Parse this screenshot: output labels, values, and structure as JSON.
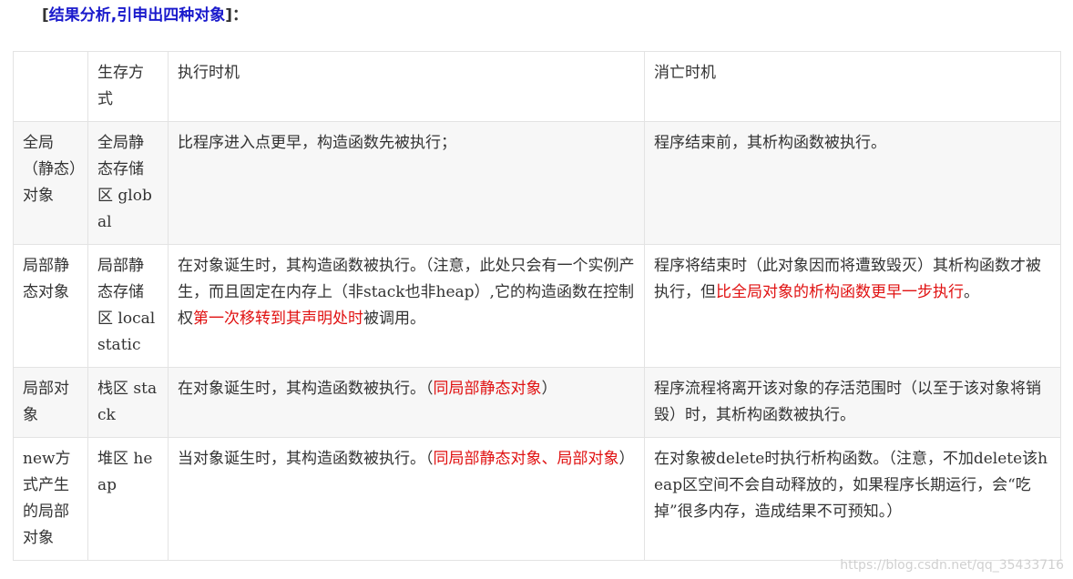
{
  "heading": {
    "open_bracket": "[",
    "text": "结果分析,引申出四种对象",
    "close": "]："
  },
  "table": {
    "header": [
      "",
      "生存方式",
      "执行时机",
      "消亡时机"
    ],
    "rows": [
      {
        "type": "全局（静态）对象",
        "storage": "全局静态存储区 global",
        "exec": [
          {
            "t": "比程序进入点更早，构造函数先被执行；",
            "red": false
          }
        ],
        "death": [
          {
            "t": "程序结束前，其析构函数被执行。",
            "red": false
          }
        ]
      },
      {
        "type": "局部静态对象",
        "storage": "局部静态存储区 local static",
        "exec": [
          {
            "t": "在对象诞生时，其构造函数被执行。（注意，此处只会有一个实例产生，而且固定在内存上（非stack也非heap）,它的构造函数在控制权",
            "red": false
          },
          {
            "t": "第一次移转到其声明处时",
            "red": true
          },
          {
            "t": "被调用。",
            "red": false
          }
        ],
        "death": [
          {
            "t": "程序将结束时（此对象因而将遭致毁灭）其析构函数才被执行，但",
            "red": false
          },
          {
            "t": "比全局对象的析构函数更早一步执行",
            "red": true
          },
          {
            "t": "。",
            "red": false
          }
        ]
      },
      {
        "type": "局部对象",
        "storage": "栈区 stack",
        "exec": [
          {
            "t": "在对象诞生时，其构造函数被执行。（",
            "red": false
          },
          {
            "t": "同局部静态对象",
            "red": true
          },
          {
            "t": "）",
            "red": false
          }
        ],
        "death": [
          {
            "t": "程序流程将离开该对象的存活范围时（以至于该对象将销毁）时，其析构函数被执行。",
            "red": false
          }
        ]
      },
      {
        "type": "new方式产生的局部对象",
        "storage": "堆区 heap",
        "exec": [
          {
            "t": "当对象诞生时，其构造函数被执行。（",
            "red": false
          },
          {
            "t": "同局部静态对象、局部对象",
            "red": true
          },
          {
            "t": "）",
            "red": false
          }
        ],
        "death": [
          {
            "t": "在对象被delete时执行析构函数。（注意，不加delete该heap区空间不会自动释放的，如果程序长期运行，会“吃掉”很多内存，造成结果不可预知。）",
            "red": false
          }
        ]
      }
    ]
  },
  "watermark": "https://blog.csdn.net/qq_35433716"
}
